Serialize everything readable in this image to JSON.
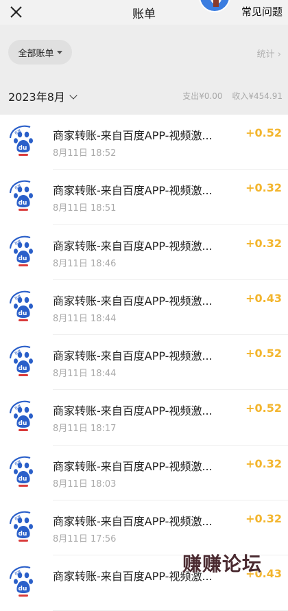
{
  "header": {
    "title": "账单",
    "faq_label": "常见问题",
    "close_icon": "close-icon"
  },
  "filter": {
    "label": "全部账单",
    "stats_label": "统计",
    "stats_chevron": "›"
  },
  "month": {
    "label": "2023年8月",
    "expense": "支出¥0.00",
    "income": "收入¥454.91"
  },
  "colors": {
    "income": "#f3b52d",
    "baidu_blue": "#2a5fc9",
    "baidu_red": "#d93a3a"
  },
  "transactions": [
    {
      "name": "商家转账-来自百度APP-视频激...",
      "time": "8月11日 18:52",
      "amount": "+0.52"
    },
    {
      "name": "商家转账-来自百度APP-视频激...",
      "time": "8月11日 18:51",
      "amount": "+0.32"
    },
    {
      "name": "商家转账-来自百度APP-视频激...",
      "time": "8月11日 18:46",
      "amount": "+0.32"
    },
    {
      "name": "商家转账-来自百度APP-视频激...",
      "time": "8月11日 18:44",
      "amount": "+0.43"
    },
    {
      "name": "商家转账-来自百度APP-视频激...",
      "time": "8月11日 18:44",
      "amount": "+0.52"
    },
    {
      "name": "商家转账-来自百度APP-视频激...",
      "time": "8月11日 18:17",
      "amount": "+0.52"
    },
    {
      "name": "商家转账-来自百度APP-视频激...",
      "time": "8月11日 18:03",
      "amount": "+0.32"
    },
    {
      "name": "商家转账-来自百度APP-视频激...",
      "time": "8月11日 17:56",
      "amount": "+0.32"
    },
    {
      "name": "商家转账-来自百度APP-视频激...",
      "time": "",
      "amount": "+0.43"
    }
  ],
  "watermark": "赚赚论坛"
}
